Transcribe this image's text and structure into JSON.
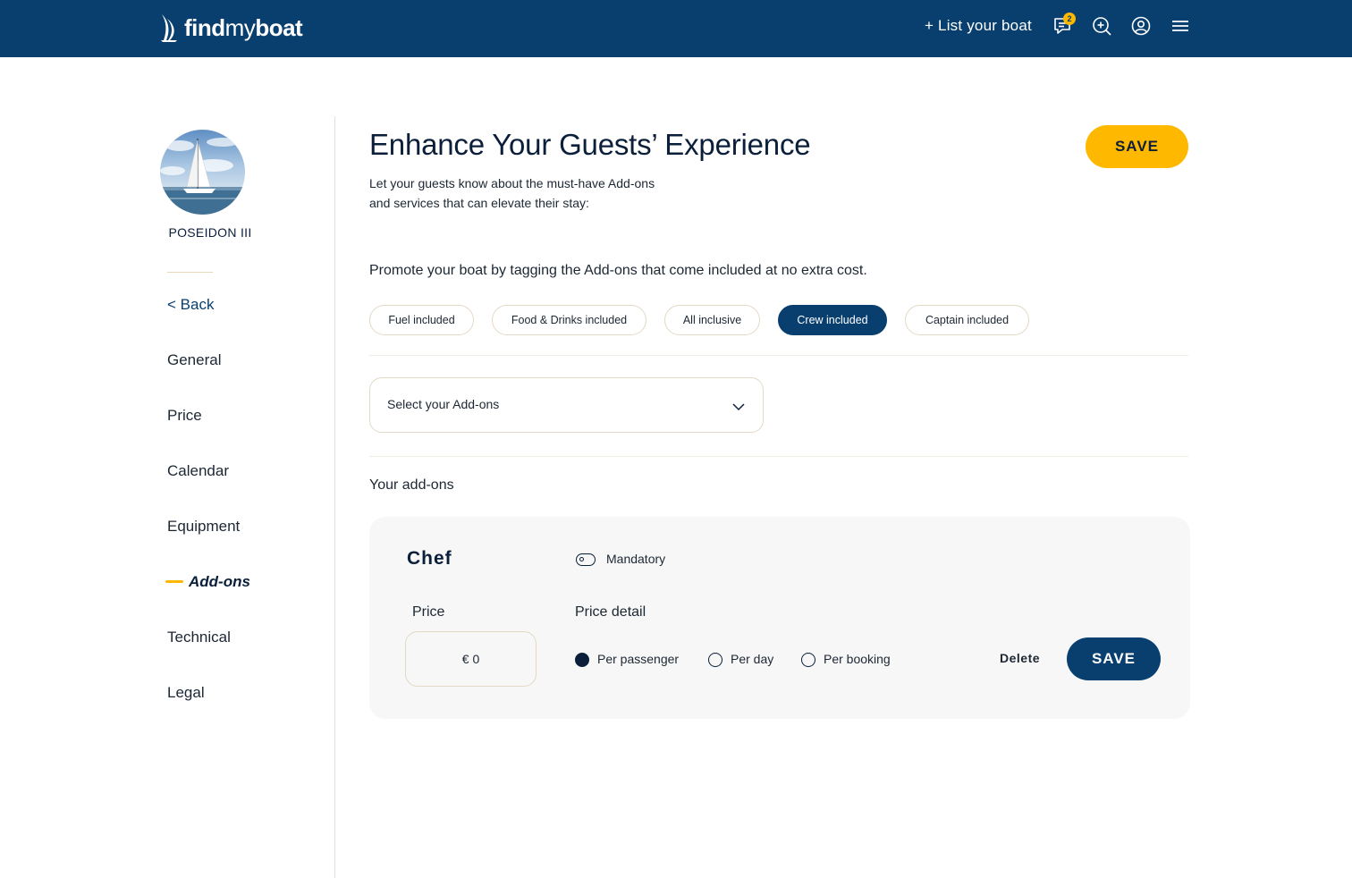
{
  "header": {
    "logo_bold": "find",
    "logo_light": "my",
    "logo_bold2": "boat",
    "list_boat": "+ List your boat",
    "messages_count": "2",
    "icons": [
      "messages-icon",
      "search-plus-icon",
      "user-icon",
      "menu-icon"
    ]
  },
  "sidebar": {
    "boat_name": "POSEIDON III",
    "back": "< Back",
    "items": [
      {
        "label": "General"
      },
      {
        "label": "Price"
      },
      {
        "label": "Calendar"
      },
      {
        "label": "Equipment"
      },
      {
        "label": "Add-ons",
        "active": true
      },
      {
        "label": "Technical"
      },
      {
        "label": "Legal"
      }
    ]
  },
  "main": {
    "title": "Enhance Your Guests’ Experience",
    "subtitle_line1": "Let your guests know about the must-have Add-ons",
    "subtitle_line2": "and services that can elevate their stay:",
    "save_label": "SAVE",
    "promo": "Promote your boat by tagging the Add-ons that come included at no extra cost.",
    "chips": [
      {
        "label": "Fuel included",
        "selected": false
      },
      {
        "label": "Food & Drinks included",
        "selected": false
      },
      {
        "label": "All inclusive",
        "selected": false
      },
      {
        "label": "Crew included",
        "selected": true
      },
      {
        "label": "Captain included",
        "selected": false
      }
    ],
    "select_placeholder": "Select your Add-ons",
    "your_addons": "Your add-ons",
    "addon": {
      "name": "Chef",
      "mandatory_label": "Mandatory",
      "mandatory_on": false,
      "price_label": "Price",
      "price_value": "€ 0",
      "detail_label": "Price detail",
      "options": [
        {
          "label": "Per passenger",
          "checked": true
        },
        {
          "label": "Per day",
          "checked": false
        },
        {
          "label": "Per booking",
          "checked": false
        }
      ],
      "delete_label": "Delete",
      "save_label": "SAVE"
    }
  },
  "colors": {
    "brand_navy": "#083f6f",
    "accent_yellow": "#ffb800",
    "card_bg": "#f7f7f7"
  }
}
